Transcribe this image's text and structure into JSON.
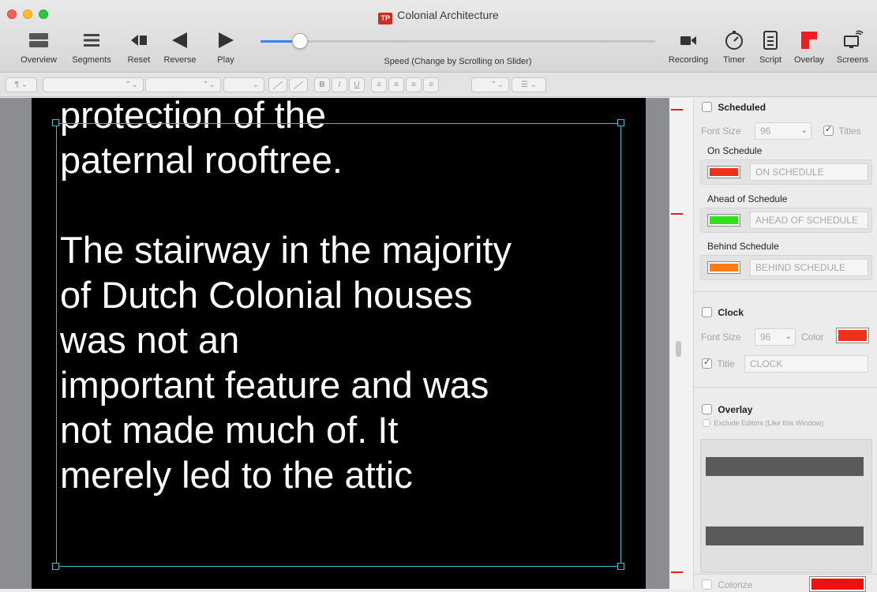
{
  "window": {
    "title": "Colonial Architecture",
    "logo_text": "TP"
  },
  "toolbar": {
    "left": [
      {
        "label": "Overview",
        "icon": "overview-icon"
      },
      {
        "label": "Segments",
        "icon": "segments-icon"
      },
      {
        "label": "Reset",
        "icon": "reset-icon"
      },
      {
        "label": "Reverse",
        "icon": "reverse-icon"
      },
      {
        "label": "Play",
        "icon": "play-icon"
      }
    ],
    "speed_label": "Speed (Change by Scrolling on Slider)",
    "speed_value": 0.1,
    "right": [
      {
        "label": "Recording",
        "icon": "recording-icon"
      },
      {
        "label": "Timer",
        "icon": "timer-icon"
      },
      {
        "label": "Script",
        "icon": "script-icon"
      },
      {
        "label": "Overlay",
        "icon": "overlay-icon"
      },
      {
        "label": "Screens",
        "icon": "screens-icon"
      }
    ]
  },
  "formatbar": {
    "paragraph_style": "¶",
    "bold": "B",
    "italic": "I",
    "underline": "U"
  },
  "editor": {
    "lines": [
      "protection of the",
      "paternal rooftree.",
      "",
      "The stairway in the majority",
      "of Dutch Colonial houses",
      "was not an",
      "important feature and was",
      "not made much of. It",
      "merely led to the attic"
    ]
  },
  "panel": {
    "scheduled": {
      "label": "Scheduled",
      "checked": false,
      "font_size_label": "Font Size",
      "font_size": "96",
      "titles_label": "Titles",
      "titles_checked": true,
      "on_schedule": {
        "label": "On Schedule",
        "text": "ON SCHEDULE",
        "color": "#f0301a"
      },
      "ahead": {
        "label": "Ahead of Schedule",
        "text": "AHEAD OF SCHEDULE",
        "color": "#2ee317"
      },
      "behind": {
        "label": "Behind Schedule",
        "text": "BEHIND SCHEDULE",
        "color": "#fb7d17"
      }
    },
    "clock": {
      "label": "Clock",
      "checked": false,
      "font_size_label": "Font Size",
      "font_size": "96",
      "color_label": "Color",
      "color": "#f0301a",
      "title_label": "Title",
      "title_checked": true,
      "title_value": "CLOCK"
    },
    "overlay": {
      "label": "Overlay",
      "checked": false,
      "exclude_label": "Exclude Editors (Like this Window)",
      "exclude_checked": false
    },
    "colorize": {
      "label": "Colorize",
      "checked": false,
      "color": "#ee1111"
    }
  }
}
